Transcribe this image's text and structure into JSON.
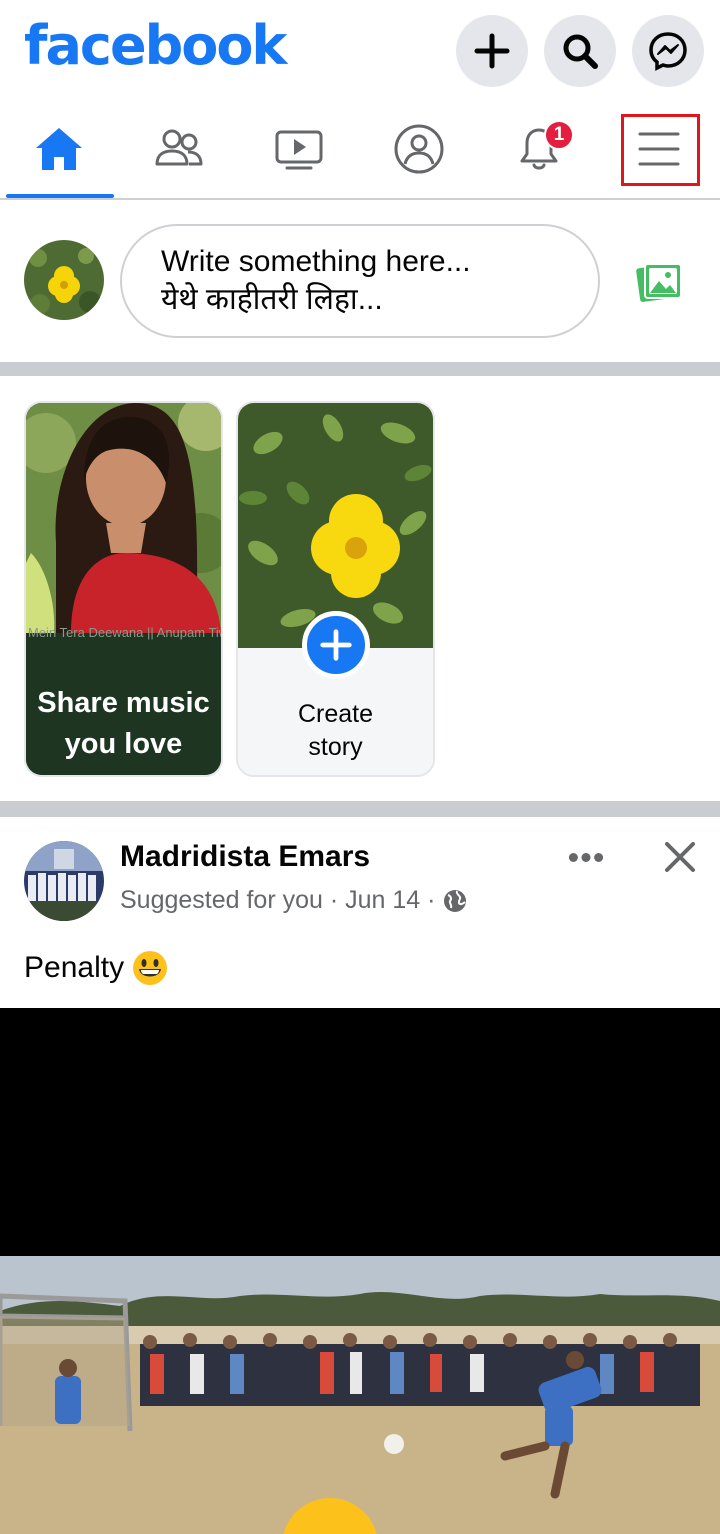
{
  "header": {
    "logo": "facebook",
    "icons": [
      "plus-icon",
      "search-icon",
      "messenger-icon"
    ]
  },
  "nav": {
    "tabs": [
      "home",
      "friends",
      "watch",
      "profile",
      "notifications",
      "menu"
    ],
    "active_tab": "home",
    "notification_count": "1"
  },
  "composer": {
    "placeholder_line1": "Write something here...",
    "placeholder_line2": "येथे काहीतरी लिहा..."
  },
  "stories": [
    {
      "label": "Share music you love",
      "caption_strip": "Mein Tera Deewana || Anupam Tiwari"
    },
    {
      "label": "Create story"
    }
  ],
  "post": {
    "author": "Madridista Emars",
    "meta": "Suggested for you · Jun 14 ·",
    "text": "Penalty"
  },
  "colors": {
    "brand": "#1877f2",
    "badge": "#e41e3f",
    "highlight_box": "#e0161e",
    "photo_icon": "#45bd62"
  }
}
